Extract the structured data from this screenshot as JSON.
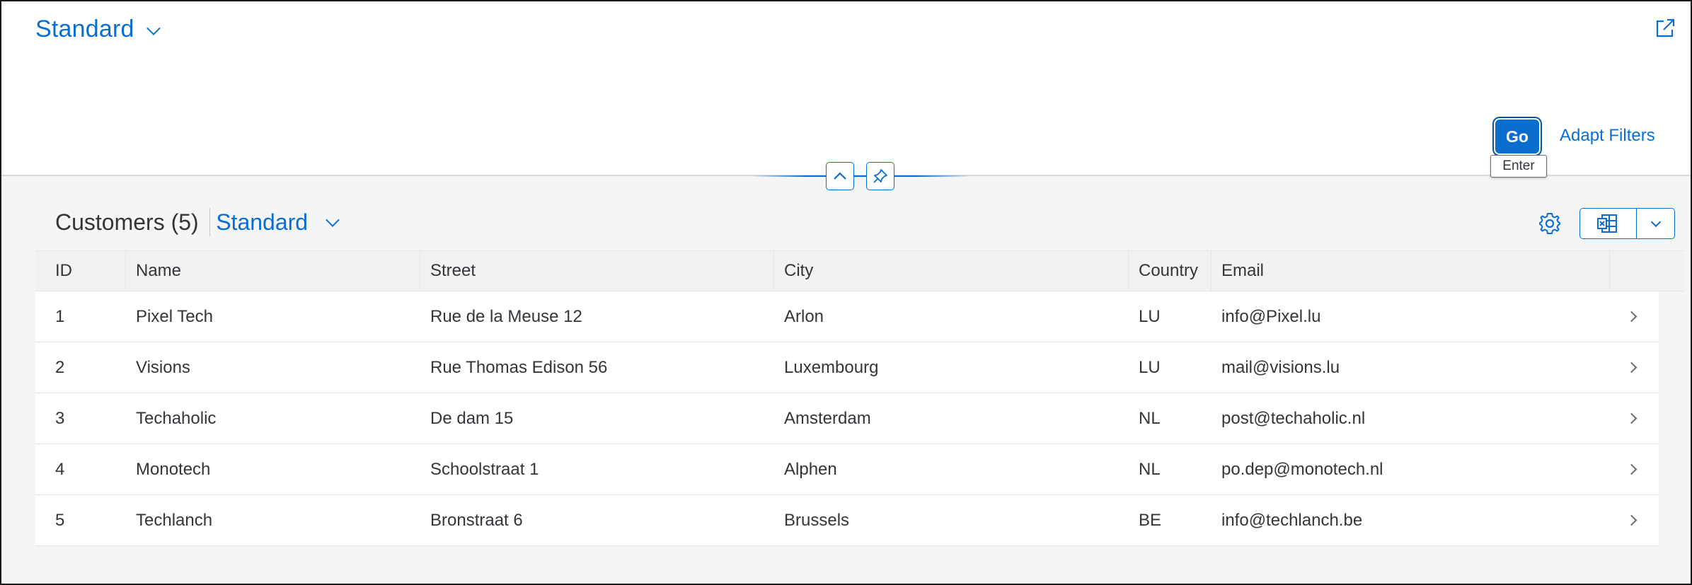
{
  "header": {
    "variant_title": "Standard",
    "go_label": "Go",
    "go_tooltip": "Enter",
    "adapt_filters_label": "Adapt Filters"
  },
  "table": {
    "title": "Customers (5)",
    "variant_title": "Standard",
    "columns": [
      "ID",
      "Name",
      "Street",
      "City",
      "Country",
      "Email"
    ],
    "rows": [
      {
        "id": "1",
        "name": "Pixel Tech",
        "street": "Rue de la Meuse 12",
        "city": "Arlon",
        "country": "LU",
        "email": "info@Pixel.lu"
      },
      {
        "id": "2",
        "name": "Visions",
        "street": "Rue Thomas Edison 56",
        "city": "Luxembourg",
        "country": "LU",
        "email": "mail@visions.lu"
      },
      {
        "id": "3",
        "name": "Techaholic",
        "street": "De dam 15",
        "city": "Amsterdam",
        "country": "NL",
        "email": "post@techaholic.nl"
      },
      {
        "id": "4",
        "name": "Monotech",
        "street": "Schoolstraat 1",
        "city": "Alphen",
        "country": "NL",
        "email": "po.dep@monotech.nl"
      },
      {
        "id": "5",
        "name": "Techlanch",
        "street": "Bronstraat 6",
        "city": "Brussels",
        "country": "BE",
        "email": "info@techlanch.be"
      }
    ]
  },
  "icons": {
    "share": "share-icon",
    "collapse": "chevron-up-icon",
    "pin": "pin-icon",
    "settings": "gear-icon",
    "export": "spreadsheet-export-icon",
    "row_nav": "chevron-right-icon"
  },
  "colors": {
    "accent": "#0a6ed1",
    "text": "#32363a",
    "background": "#f5f5f5",
    "header_row": "#f2f2f2"
  }
}
